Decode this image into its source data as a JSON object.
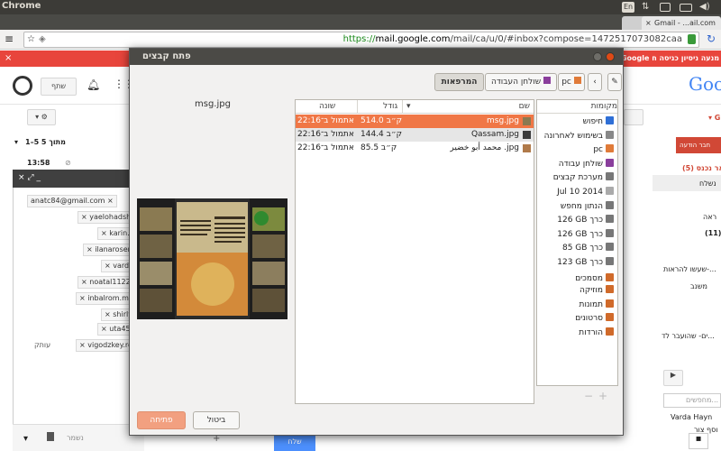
{
  "system": {
    "app_title": "Chrome",
    "keyboard_layout": "En"
  },
  "browser": {
    "tab_active": "Gmail - ...ail.com",
    "url_scheme": "https://",
    "url_host": "mail.google.com",
    "url_path": "/mail/ca/u/0/#inbox?compose=1472517073082caa"
  },
  "gmail": {
    "banner_text": "Google מנעה ניסיון כניסה ח",
    "share_label": "שתף",
    "pagination": "1–5 מתוך 5",
    "time": "13:58",
    "compose_label": "חבר הודעה",
    "inbox_label": "דואר נכנס (5)",
    "sent_label": "נשלח",
    "drafts_count": "(11)",
    "recipients": [
      "anatc84@gmail.com",
      "yaelohadsha",
      "karin.m",
      "ilanarosent",
      "vardit",
      "noatal1122@",
      "inbalrom.me",
      "shirlyb",
      "uta45@",
      "vigodzkey.ro"
    ],
    "advanced_label": "עותק",
    "send_button": "שלח",
    "save_label": "נשמר",
    "right_snippets": [
      "ראה",
      "שעשו להראות-...",
      "משנב",
      "ים- שהועבר לד...",
      "Varda Hayn",
      "מחפשים...",
      "וסף צור"
    ],
    "logo_text": "Goo"
  },
  "dialog": {
    "title": "פתח קבצים",
    "path_buttons": [
      "המרפאות",
      "שולחן העבודה",
      "pc"
    ],
    "places_header": "מקומות",
    "places": [
      {
        "label": "חיפוש",
        "icon": "search-icon",
        "color": "#2f6fd6"
      },
      {
        "label": "בשימוש לאחרונה",
        "icon": "clock-icon",
        "color": "#888888"
      },
      {
        "label": "pc",
        "icon": "home-folder-icon",
        "color": "#e07b39"
      },
      {
        "label": "שולחן עבודה",
        "icon": "desktop-icon",
        "color": "#8a3e9c"
      },
      {
        "label": "מערכת קבצים",
        "icon": "drive-icon",
        "color": "#777777"
      },
      {
        "label": "Jul 10 2014",
        "icon": "disc-icon",
        "color": "#aaaaaa"
      },
      {
        "label": "הנתון מחפש",
        "icon": "drive-icon",
        "color": "#777777"
      },
      {
        "label": "126 GB כרך",
        "icon": "drive-icon",
        "color": "#777777"
      },
      {
        "label": "126 GB כרך",
        "icon": "drive-icon",
        "color": "#777777"
      },
      {
        "label": "85 GB כרך",
        "icon": "drive-icon",
        "color": "#777777"
      },
      {
        "label": "123 GB כרך",
        "icon": "drive-icon",
        "color": "#777777"
      },
      {
        "label": "מסמכים",
        "icon": "documents-folder-icon",
        "color": "#d06a2a"
      },
      {
        "label": "מוזיקה",
        "icon": "music-folder-icon",
        "color": "#d06a2a"
      },
      {
        "label": "תמונות",
        "icon": "pictures-folder-icon",
        "color": "#d06a2a"
      },
      {
        "label": "סרטונים",
        "icon": "videos-folder-icon",
        "color": "#d06a2a"
      },
      {
        "label": "הורדות",
        "icon": "downloads-folder-icon",
        "color": "#d06a2a"
      }
    ],
    "columns": {
      "name": "שם",
      "size": "גודל",
      "modified": "שונה"
    },
    "files": [
      {
        "name": "msg.jpg",
        "size": "514.0 ק״ב",
        "modified": "אתמול ב־22:16",
        "selected": true
      },
      {
        "name": "Qassam.jpg",
        "size": "144.4 ק״ב",
        "modified": "אתמול ב־22:16",
        "selected": false
      },
      {
        "name": "محمد أبو خضير .jpg",
        "size": "85.5 ק״ב",
        "modified": "אתמול ב־22:16",
        "selected": false
      }
    ],
    "preview_filename": "msg.jpg",
    "cancel_button": "ביטול",
    "open_button": "פתיחה",
    "accent_color": "#f07746"
  }
}
